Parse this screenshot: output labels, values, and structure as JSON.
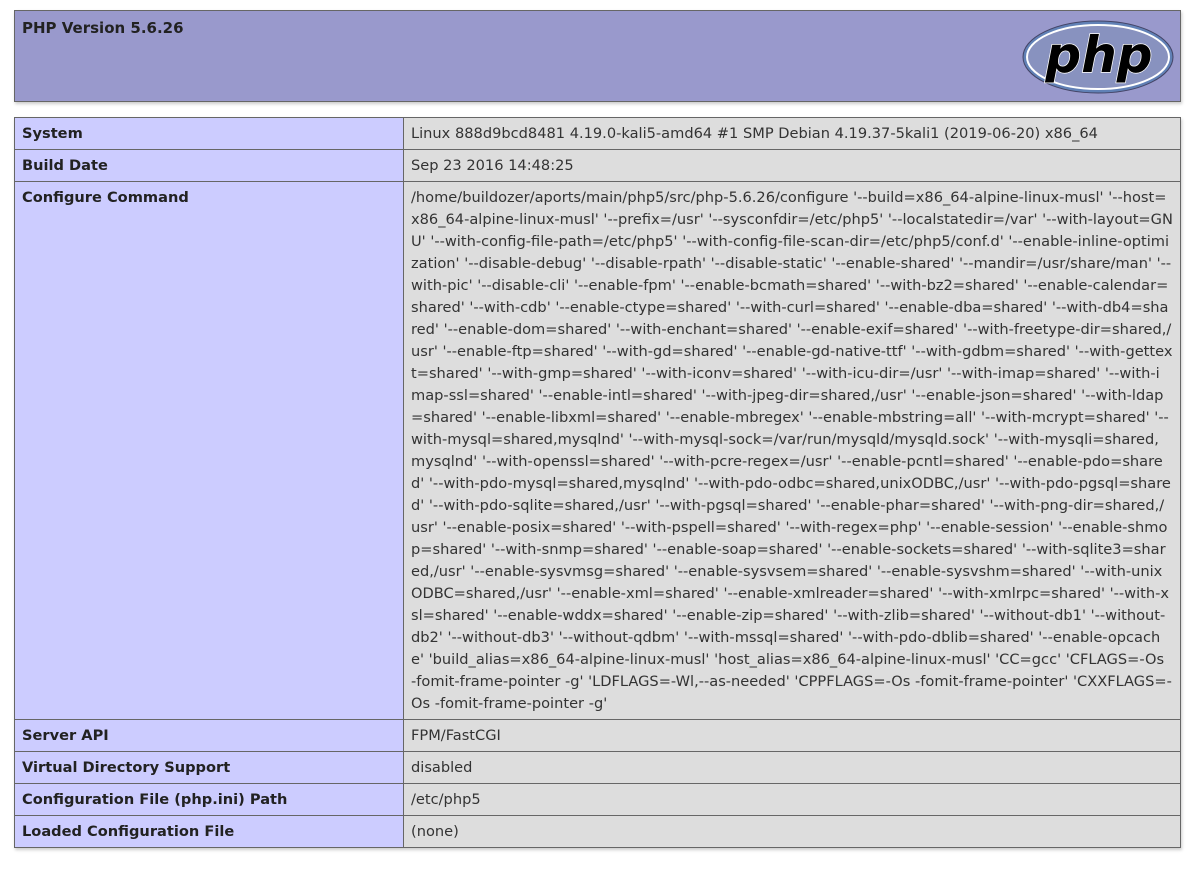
{
  "header": {
    "title": "PHP Version 5.6.26",
    "logo_text": "php"
  },
  "colors": {
    "header_bg": "#9999cc",
    "key_cell_bg": "#ccccff",
    "value_cell_bg": "#dddddd",
    "border": "#666666"
  },
  "rows": [
    {
      "key": "System",
      "value": "Linux 888d9bcd8481 4.19.0-kali5-amd64 #1 SMP Debian 4.19.37-5kali1 (2019-06-20) x86_64"
    },
    {
      "key": "Build Date",
      "value": "Sep 23 2016 14:48:25"
    },
    {
      "key": "Configure Command",
      "value": "/home/buildozer/aports/main/php5/src/php-5.6.26/configure '--build=x86_64-alpine-linux-musl' '--host=x86_64-alpine-linux-musl' '--prefix=/usr' '--sysconfdir=/etc/php5' '--localstatedir=/var' '--with-layout=GNU' '--with-config-file-path=/etc/php5' '--with-config-file-scan-dir=/etc/php5/conf.d' '--enable-inline-optimization' '--disable-debug' '--disable-rpath' '--disable-static' '--enable-shared' '--mandir=/usr/share/man' '--with-pic' '--disable-cli' '--enable-fpm' '--enable-bcmath=shared' '--with-bz2=shared' '--enable-calendar=shared' '--with-cdb' '--enable-ctype=shared' '--with-curl=shared' '--enable-dba=shared' '--with-db4=shared' '--enable-dom=shared' '--with-enchant=shared' '--enable-exif=shared' '--with-freetype-dir=shared,/usr' '--enable-ftp=shared' '--with-gd=shared' '--enable-gd-native-ttf' '--with-gdbm=shared' '--with-gettext=shared' '--with-gmp=shared' '--with-iconv=shared' '--with-icu-dir=/usr' '--with-imap=shared' '--with-imap-ssl=shared' '--enable-intl=shared' '--with-jpeg-dir=shared,/usr' '--enable-json=shared' '--with-ldap=shared' '--enable-libxml=shared' '--enable-mbregex' '--enable-mbstring=all' '--with-mcrypt=shared' '--with-mysql=shared,mysqlnd' '--with-mysql-sock=/var/run/mysqld/mysqld.sock' '--with-mysqli=shared,mysqlnd' '--with-openssl=shared' '--with-pcre-regex=/usr' '--enable-pcntl=shared' '--enable-pdo=shared' '--with-pdo-mysql=shared,mysqlnd' '--with-pdo-odbc=shared,unixODBC,/usr' '--with-pdo-pgsql=shared' '--with-pdo-sqlite=shared,/usr' '--with-pgsql=shared' '--enable-phar=shared' '--with-png-dir=shared,/usr' '--enable-posix=shared' '--with-pspell=shared' '--with-regex=php' '--enable-session' '--enable-shmop=shared' '--with-snmp=shared' '--enable-soap=shared' '--enable-sockets=shared' '--with-sqlite3=shared,/usr' '--enable-sysvmsg=shared' '--enable-sysvsem=shared' '--enable-sysvshm=shared' '--with-unixODBC=shared,/usr' '--enable-xml=shared' '--enable-xmlreader=shared' '--with-xmlrpc=shared' '--with-xsl=shared' '--enable-wddx=shared' '--enable-zip=shared' '--with-zlib=shared' '--without-db1' '--without-db2' '--without-db3' '--without-qdbm' '--with-mssql=shared' '--with-pdo-dblib=shared' '--enable-opcache' 'build_alias=x86_64-alpine-linux-musl' 'host_alias=x86_64-alpine-linux-musl' 'CC=gcc' 'CFLAGS=-Os -fomit-frame-pointer -g' 'LDFLAGS=-Wl,--as-needed' 'CPPFLAGS=-Os -fomit-frame-pointer' 'CXXFLAGS=-Os -fomit-frame-pointer -g'"
    },
    {
      "key": "Server API",
      "value": "FPM/FastCGI"
    },
    {
      "key": "Virtual Directory Support",
      "value": "disabled"
    },
    {
      "key": "Configuration File (php.ini) Path",
      "value": "/etc/php5"
    },
    {
      "key": "Loaded Configuration File",
      "value": "(none)"
    }
  ]
}
